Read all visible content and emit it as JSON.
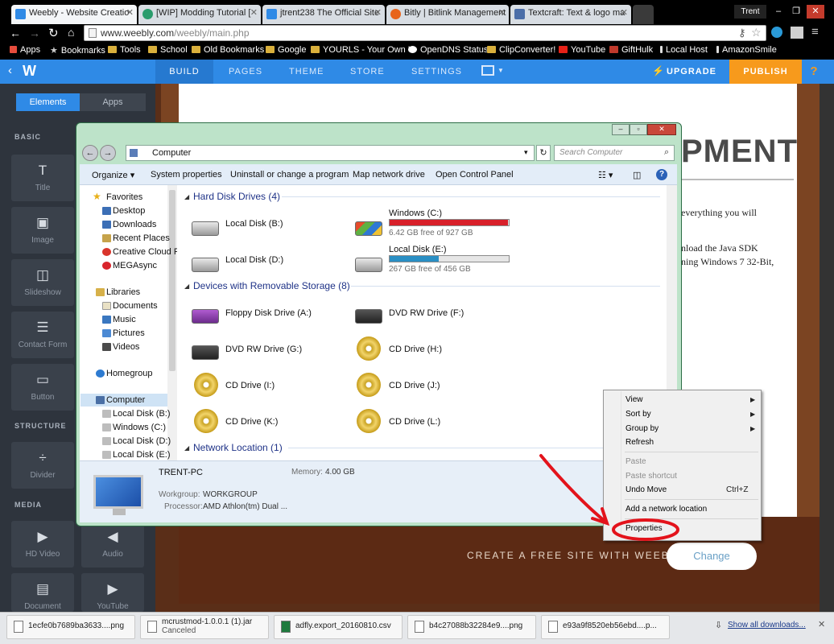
{
  "browser": {
    "tabs": [
      {
        "title": "Weebly - Website Creatio",
        "active": true,
        "color": "#2f8ae6"
      },
      {
        "title": "[WIP] Modding Tutorial [",
        "active": false,
        "color": "#2a9c6c"
      },
      {
        "title": "jtrent238 The Official Site",
        "active": false,
        "color": "#2f8ae6"
      },
      {
        "title": "Bitly | Bitlink Management",
        "active": false,
        "color": "#e8641b"
      },
      {
        "title": "Textcraft: Text & logo ma",
        "active": false,
        "color": "#4b6ea8"
      }
    ],
    "user": "Trent",
    "url_host": "www.weebly.com",
    "url_path": "/weebly/main.php",
    "bookmarks": [
      "Apps",
      "Bookmarks",
      "Tools",
      "School",
      "Old Bookmarks",
      "Google",
      "YOURLS - Your Own U",
      "OpenDNS Status",
      "ClipConverter!",
      "YouTube",
      "GiftHulk",
      "Local Host",
      "AmazonSmile"
    ]
  },
  "weebly": {
    "nav": {
      "build": "BUILD",
      "pages": "PAGES",
      "theme": "THEME",
      "store": "STORE",
      "settings": "SETTINGS",
      "upgrade": "UPGRADE",
      "publish": "PUBLISH",
      "help": "?"
    },
    "sidebar": {
      "tab_elements": "Elements",
      "tab_apps": "Apps",
      "sections": {
        "basic": "BASIC",
        "structure": "STRUCTURE",
        "media": "MEDIA"
      },
      "elements": [
        {
          "label": "Title",
          "icon": "T"
        },
        {
          "label": "Image",
          "icon": "▣"
        },
        {
          "label": "Slideshow",
          "icon": "◫"
        },
        {
          "label": "Contact Form",
          "icon": "☰"
        },
        {
          "label": "Button",
          "icon": "▭"
        },
        {
          "label": "Divider",
          "icon": "÷"
        },
        {
          "label": "HD Video",
          "icon": "▶"
        },
        {
          "label": "Audio",
          "icon": "◀"
        },
        {
          "label": "Document",
          "icon": "▤"
        },
        {
          "label": "YouTube",
          "icon": "▶"
        }
      ]
    },
    "page": {
      "banner_text": "PMENT",
      "line1": "everything you will",
      "line2": "nload the Java SDK",
      "line3": "ning Windows 7 32-Bit,",
      "footer_text": "CREATE A FREE SITE WITH WEEBLY",
      "change_label": "Change"
    }
  },
  "explorer": {
    "breadcrumb": "Computer",
    "search_placeholder": "Search Computer",
    "commands": [
      "Organize ▾",
      "System properties",
      "Uninstall or change a program",
      "Map network drive",
      "Open Control Panel"
    ],
    "nav": {
      "favorites": "Favorites",
      "favorite_items": [
        "Desktop",
        "Downloads",
        "Recent Places",
        "Creative Cloud F",
        "MEGAsync"
      ],
      "libraries": "Libraries",
      "library_items": [
        "Documents",
        "Music",
        "Pictures",
        "Videos"
      ],
      "homegroup": "Homegroup",
      "computer": "Computer",
      "computer_items": [
        "Local Disk (B:)",
        "Windows (C:)",
        "Local Disk (D:)",
        "Local Disk (E:)"
      ]
    },
    "groups": {
      "hdd": "Hard Disk Drives (4)",
      "removable": "Devices with Removable Storage (8)",
      "network": "Network Location (1)"
    },
    "hdd": [
      {
        "name": "Local Disk (B:)"
      },
      {
        "name": "Windows (C:)",
        "free": "6.42 GB free of 927 GB",
        "used_fraction": 0.993,
        "bar_color": "#d8202a"
      },
      {
        "name": "Local Disk (D:)"
      },
      {
        "name": "Local Disk (E:)",
        "free": "267 GB free of 456 GB",
        "used_fraction": 0.41,
        "bar_color": "#2a8fc4"
      }
    ],
    "removable": [
      "Floppy Disk Drive (A:)",
      "DVD RW Drive (F:)",
      "DVD RW Drive (G:)",
      "CD Drive (H:)",
      "CD Drive (I:)",
      "CD Drive (J:)",
      "CD Drive (K:)",
      "CD Drive (L:)"
    ],
    "details": {
      "pc": "TRENT-PC",
      "workgroup_label": "Workgroup:",
      "workgroup": "WORKGROUP",
      "memory_label": "Memory:",
      "memory": "4.00 GB",
      "processor_label": "Processor:",
      "processor": "AMD Athlon(tm) Dual ..."
    }
  },
  "context_menu": {
    "items": [
      "View",
      "Sort by",
      "Group by",
      "Refresh",
      "Paste",
      "Paste shortcut",
      "Undo Move",
      "Add a network location",
      "Properties"
    ],
    "undo_shortcut": "Ctrl+Z"
  },
  "downloads": [
    {
      "name": "1ecfe0b7689ba3633....png",
      "sub": ""
    },
    {
      "name": "mcrustmod-1.0.0.1 (1).jar",
      "sub": "Canceled"
    },
    {
      "name": "adfly.export_20160810.csv",
      "sub": ""
    },
    {
      "name": "b4c27088b32284e9....png",
      "sub": ""
    },
    {
      "name": "e93a9f8520eb56ebd....p...",
      "sub": ""
    }
  ],
  "show_all_downloads": "Show all downloads..."
}
